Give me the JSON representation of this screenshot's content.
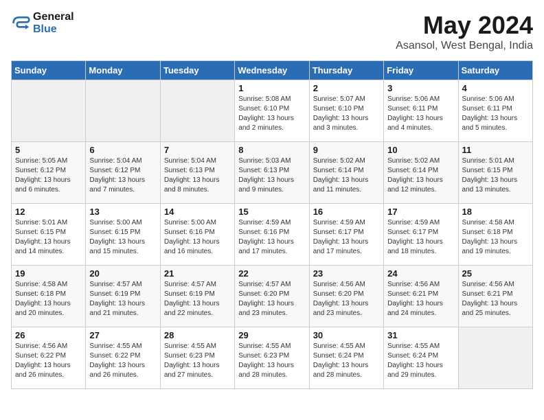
{
  "logo": {
    "line1": "General",
    "line2": "Blue"
  },
  "title": "May 2024",
  "location": "Asansol, West Bengal, India",
  "days_header": [
    "Sunday",
    "Monday",
    "Tuesday",
    "Wednesday",
    "Thursday",
    "Friday",
    "Saturday"
  ],
  "weeks": [
    [
      {
        "day": "",
        "info": ""
      },
      {
        "day": "",
        "info": ""
      },
      {
        "day": "",
        "info": ""
      },
      {
        "day": "1",
        "info": "Sunrise: 5:08 AM\nSunset: 6:10 PM\nDaylight: 13 hours\nand 2 minutes."
      },
      {
        "day": "2",
        "info": "Sunrise: 5:07 AM\nSunset: 6:10 PM\nDaylight: 13 hours\nand 3 minutes."
      },
      {
        "day": "3",
        "info": "Sunrise: 5:06 AM\nSunset: 6:11 PM\nDaylight: 13 hours\nand 4 minutes."
      },
      {
        "day": "4",
        "info": "Sunrise: 5:06 AM\nSunset: 6:11 PM\nDaylight: 13 hours\nand 5 minutes."
      }
    ],
    [
      {
        "day": "5",
        "info": "Sunrise: 5:05 AM\nSunset: 6:12 PM\nDaylight: 13 hours\nand 6 minutes."
      },
      {
        "day": "6",
        "info": "Sunrise: 5:04 AM\nSunset: 6:12 PM\nDaylight: 13 hours\nand 7 minutes."
      },
      {
        "day": "7",
        "info": "Sunrise: 5:04 AM\nSunset: 6:13 PM\nDaylight: 13 hours\nand 8 minutes."
      },
      {
        "day": "8",
        "info": "Sunrise: 5:03 AM\nSunset: 6:13 PM\nDaylight: 13 hours\nand 9 minutes."
      },
      {
        "day": "9",
        "info": "Sunrise: 5:02 AM\nSunset: 6:14 PM\nDaylight: 13 hours\nand 11 minutes."
      },
      {
        "day": "10",
        "info": "Sunrise: 5:02 AM\nSunset: 6:14 PM\nDaylight: 13 hours\nand 12 minutes."
      },
      {
        "day": "11",
        "info": "Sunrise: 5:01 AM\nSunset: 6:15 PM\nDaylight: 13 hours\nand 13 minutes."
      }
    ],
    [
      {
        "day": "12",
        "info": "Sunrise: 5:01 AM\nSunset: 6:15 PM\nDaylight: 13 hours\nand 14 minutes."
      },
      {
        "day": "13",
        "info": "Sunrise: 5:00 AM\nSunset: 6:15 PM\nDaylight: 13 hours\nand 15 minutes."
      },
      {
        "day": "14",
        "info": "Sunrise: 5:00 AM\nSunset: 6:16 PM\nDaylight: 13 hours\nand 16 minutes."
      },
      {
        "day": "15",
        "info": "Sunrise: 4:59 AM\nSunset: 6:16 PM\nDaylight: 13 hours\nand 17 minutes."
      },
      {
        "day": "16",
        "info": "Sunrise: 4:59 AM\nSunset: 6:17 PM\nDaylight: 13 hours\nand 17 minutes."
      },
      {
        "day": "17",
        "info": "Sunrise: 4:59 AM\nSunset: 6:17 PM\nDaylight: 13 hours\nand 18 minutes."
      },
      {
        "day": "18",
        "info": "Sunrise: 4:58 AM\nSunset: 6:18 PM\nDaylight: 13 hours\nand 19 minutes."
      }
    ],
    [
      {
        "day": "19",
        "info": "Sunrise: 4:58 AM\nSunset: 6:18 PM\nDaylight: 13 hours\nand 20 minutes."
      },
      {
        "day": "20",
        "info": "Sunrise: 4:57 AM\nSunset: 6:19 PM\nDaylight: 13 hours\nand 21 minutes."
      },
      {
        "day": "21",
        "info": "Sunrise: 4:57 AM\nSunset: 6:19 PM\nDaylight: 13 hours\nand 22 minutes."
      },
      {
        "day": "22",
        "info": "Sunrise: 4:57 AM\nSunset: 6:20 PM\nDaylight: 13 hours\nand 23 minutes."
      },
      {
        "day": "23",
        "info": "Sunrise: 4:56 AM\nSunset: 6:20 PM\nDaylight: 13 hours\nand 23 minutes."
      },
      {
        "day": "24",
        "info": "Sunrise: 4:56 AM\nSunset: 6:21 PM\nDaylight: 13 hours\nand 24 minutes."
      },
      {
        "day": "25",
        "info": "Sunrise: 4:56 AM\nSunset: 6:21 PM\nDaylight: 13 hours\nand 25 minutes."
      }
    ],
    [
      {
        "day": "26",
        "info": "Sunrise: 4:56 AM\nSunset: 6:22 PM\nDaylight: 13 hours\nand 26 minutes."
      },
      {
        "day": "27",
        "info": "Sunrise: 4:55 AM\nSunset: 6:22 PM\nDaylight: 13 hours\nand 26 minutes."
      },
      {
        "day": "28",
        "info": "Sunrise: 4:55 AM\nSunset: 6:23 PM\nDaylight: 13 hours\nand 27 minutes."
      },
      {
        "day": "29",
        "info": "Sunrise: 4:55 AM\nSunset: 6:23 PM\nDaylight: 13 hours\nand 28 minutes."
      },
      {
        "day": "30",
        "info": "Sunrise: 4:55 AM\nSunset: 6:24 PM\nDaylight: 13 hours\nand 28 minutes."
      },
      {
        "day": "31",
        "info": "Sunrise: 4:55 AM\nSunset: 6:24 PM\nDaylight: 13 hours\nand 29 minutes."
      },
      {
        "day": "",
        "info": ""
      }
    ]
  ]
}
